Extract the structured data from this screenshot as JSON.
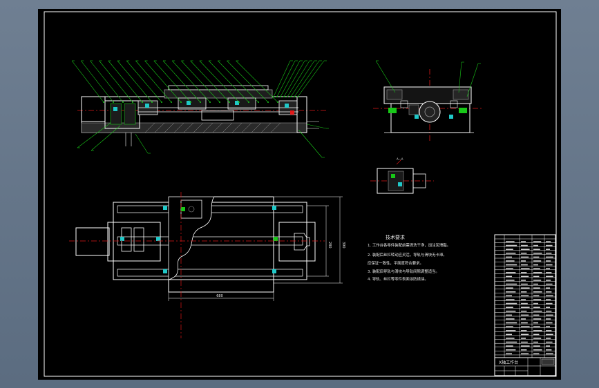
{
  "colors": {
    "background": "#65758a",
    "sheet": "#000000",
    "line_white": "#ffffff",
    "line_green": "#18c818",
    "line_red": "#e01818",
    "line_gray": "#9a9a9a",
    "line_cyan": "#20c8c8"
  },
  "technical_requirements": {
    "title": "技术要求",
    "items": [
      "1. 工作台各零件装配前需清洗干净，加注润滑脂。",
      "2. 装配后丝杠转动应灵活，导轨与滑块无卡滞。",
      "  应保证一致性，平面度符合要求。",
      "3. 装配后导轨与滑块与导轨间隙调整适当。",
      "4. 导轨、丝杠等零件表面涂防锈油。"
    ]
  },
  "title_block": {
    "drawing_name": "X轴工作台"
  },
  "dimensions": {
    "overall_length": "680",
    "height_right": "390",
    "height_inner": "280"
  },
  "balloon_count_top": 27,
  "balloon_count_side": 3
}
